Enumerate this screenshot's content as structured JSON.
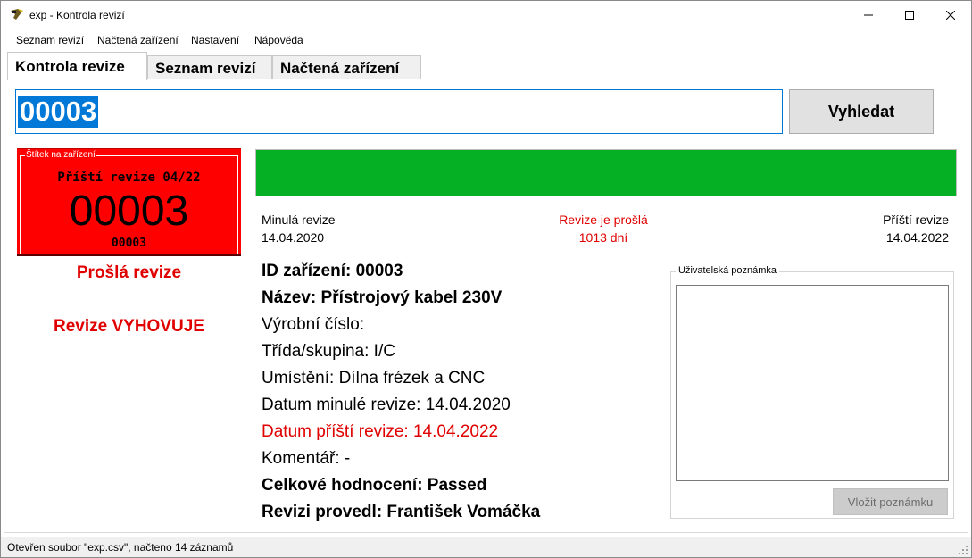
{
  "window": {
    "title": "exp - Kontrola revizí",
    "icon": "tester-icon"
  },
  "menu": {
    "items": [
      "Seznam revizí",
      "Načtená zařízení",
      "Nastavení",
      "Nápověda"
    ]
  },
  "tabs": {
    "items": [
      "Kontrola revize",
      "Seznam revizí",
      "Načtená zařízení"
    ],
    "active": "Kontrola revize"
  },
  "search": {
    "value": "00003",
    "button_label": "Vyhledat"
  },
  "label": {
    "legend": "Štítek na zařízení",
    "next_revision": "Příští revize 04/22",
    "big_id": "00003",
    "small_id": "00003",
    "color": "#ff0000"
  },
  "status": {
    "expired": "Prošlá revize",
    "result": "Revize VYHOVUJE",
    "color": "#e00000"
  },
  "progress": {
    "percent": 100,
    "color": "#06b025"
  },
  "dates": {
    "prev_label": "Minulá revize",
    "prev_value": "14.04.2020",
    "mid_label": "Revize je prošlá",
    "mid_value": "1013 dní",
    "next_label": "Příští revize",
    "next_value": "14.04.2022"
  },
  "details": {
    "id": "ID zařízení: 00003",
    "name": "Název: Přístrojový kabel 230V",
    "serial": "Výrobní číslo:",
    "class": "Třída/skupina: I/C",
    "location": "Umístění: Dílna frézek a CNC",
    "prev_date": "Datum minulé revize: 14.04.2020",
    "next_date": "Datum příští revize: 14.04.2022",
    "comment": "Komentář: -",
    "overall": "Celkové hodnocení: Passed",
    "performed_by": "Revizi provedl: František Vomáčka"
  },
  "note": {
    "legend": "Uživatelská poznámka",
    "value": "",
    "button_label": "Vložit poznámku"
  },
  "statusbar": {
    "text": "Otevřen soubor \"exp.csv\", načteno 14 záznamů"
  }
}
